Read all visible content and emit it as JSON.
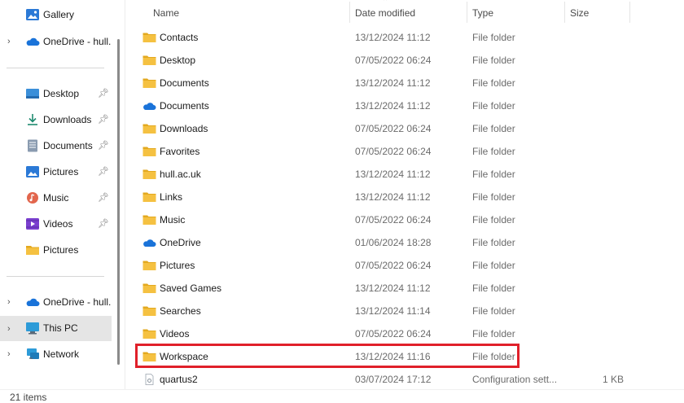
{
  "sidebar": {
    "items": [
      {
        "label": "Gallery",
        "icon": "gallery-icon",
        "chevron": false,
        "pinned": false
      },
      {
        "label": "OneDrive - hull.",
        "icon": "onedrive-cloud-icon",
        "chevron": true,
        "pinned": false
      },
      {
        "label": "Desktop",
        "icon": "desktop-icon",
        "chevron": false,
        "pinned": true
      },
      {
        "label": "Downloads",
        "icon": "download-arrow-icon",
        "chevron": false,
        "pinned": true
      },
      {
        "label": "Documents",
        "icon": "document-icon",
        "chevron": false,
        "pinned": true
      },
      {
        "label": "Pictures",
        "icon": "pictures-icon",
        "chevron": false,
        "pinned": true
      },
      {
        "label": "Music",
        "icon": "music-icon",
        "chevron": false,
        "pinned": true
      },
      {
        "label": "Videos",
        "icon": "videos-icon",
        "chevron": false,
        "pinned": true
      },
      {
        "label": "Pictures",
        "icon": "folder-icon",
        "chevron": false,
        "pinned": false
      },
      {
        "label": "OneDrive - hull.",
        "icon": "onedrive-cloud-icon",
        "chevron": true,
        "pinned": false
      },
      {
        "label": "This PC",
        "icon": "this-pc-icon",
        "chevron": true,
        "pinned": false,
        "selected": true
      },
      {
        "label": "Network",
        "icon": "network-icon",
        "chevron": true,
        "pinned": false
      }
    ]
  },
  "columns": {
    "name": "Name",
    "date": "Date modified",
    "type": "Type",
    "size": "Size"
  },
  "rows": [
    {
      "name": "Contacts",
      "date": "13/12/2024 11:12",
      "type": "File folder",
      "size": "",
      "icon": "folder"
    },
    {
      "name": "Desktop",
      "date": "07/05/2022 06:24",
      "type": "File folder",
      "size": "",
      "icon": "folder"
    },
    {
      "name": "Documents",
      "date": "13/12/2024 11:12",
      "type": "File folder",
      "size": "",
      "icon": "folder"
    },
    {
      "name": "Documents",
      "date": "13/12/2024 11:12",
      "type": "File folder",
      "size": "",
      "icon": "cloud"
    },
    {
      "name": "Downloads",
      "date": "07/05/2022 06:24",
      "type": "File folder",
      "size": "",
      "icon": "folder"
    },
    {
      "name": "Favorites",
      "date": "07/05/2022 06:24",
      "type": "File folder",
      "size": "",
      "icon": "folder"
    },
    {
      "name": "hull.ac.uk",
      "date": "13/12/2024 11:12",
      "type": "File folder",
      "size": "",
      "icon": "folder"
    },
    {
      "name": "Links",
      "date": "13/12/2024 11:12",
      "type": "File folder",
      "size": "",
      "icon": "folder"
    },
    {
      "name": "Music",
      "date": "07/05/2022 06:24",
      "type": "File folder",
      "size": "",
      "icon": "folder"
    },
    {
      "name": "OneDrive",
      "date": "01/06/2024 18:28",
      "type": "File folder",
      "size": "",
      "icon": "cloud"
    },
    {
      "name": "Pictures",
      "date": "07/05/2022 06:24",
      "type": "File folder",
      "size": "",
      "icon": "folder"
    },
    {
      "name": "Saved Games",
      "date": "13/12/2024 11:12",
      "type": "File folder",
      "size": "",
      "icon": "folder"
    },
    {
      "name": "Searches",
      "date": "13/12/2024 11:14",
      "type": "File folder",
      "size": "",
      "icon": "folder"
    },
    {
      "name": "Videos",
      "date": "07/05/2022 06:24",
      "type": "File folder",
      "size": "",
      "icon": "folder"
    },
    {
      "name": "Workspace",
      "date": "13/12/2024 11:16",
      "type": "File folder",
      "size": "",
      "icon": "folder",
      "highlighted": true
    },
    {
      "name": "quartus2",
      "date": "03/07/2024 17:12",
      "type": "Configuration sett...",
      "size": "1 KB",
      "icon": "file"
    }
  ],
  "status": {
    "count": "21 items"
  },
  "colors": {
    "folder": "#f5c141",
    "folder_dark": "#e3a91f",
    "cloud": "#1a73d9",
    "highlight": "#e0202a",
    "selected_bg": "#e5e5e5"
  }
}
